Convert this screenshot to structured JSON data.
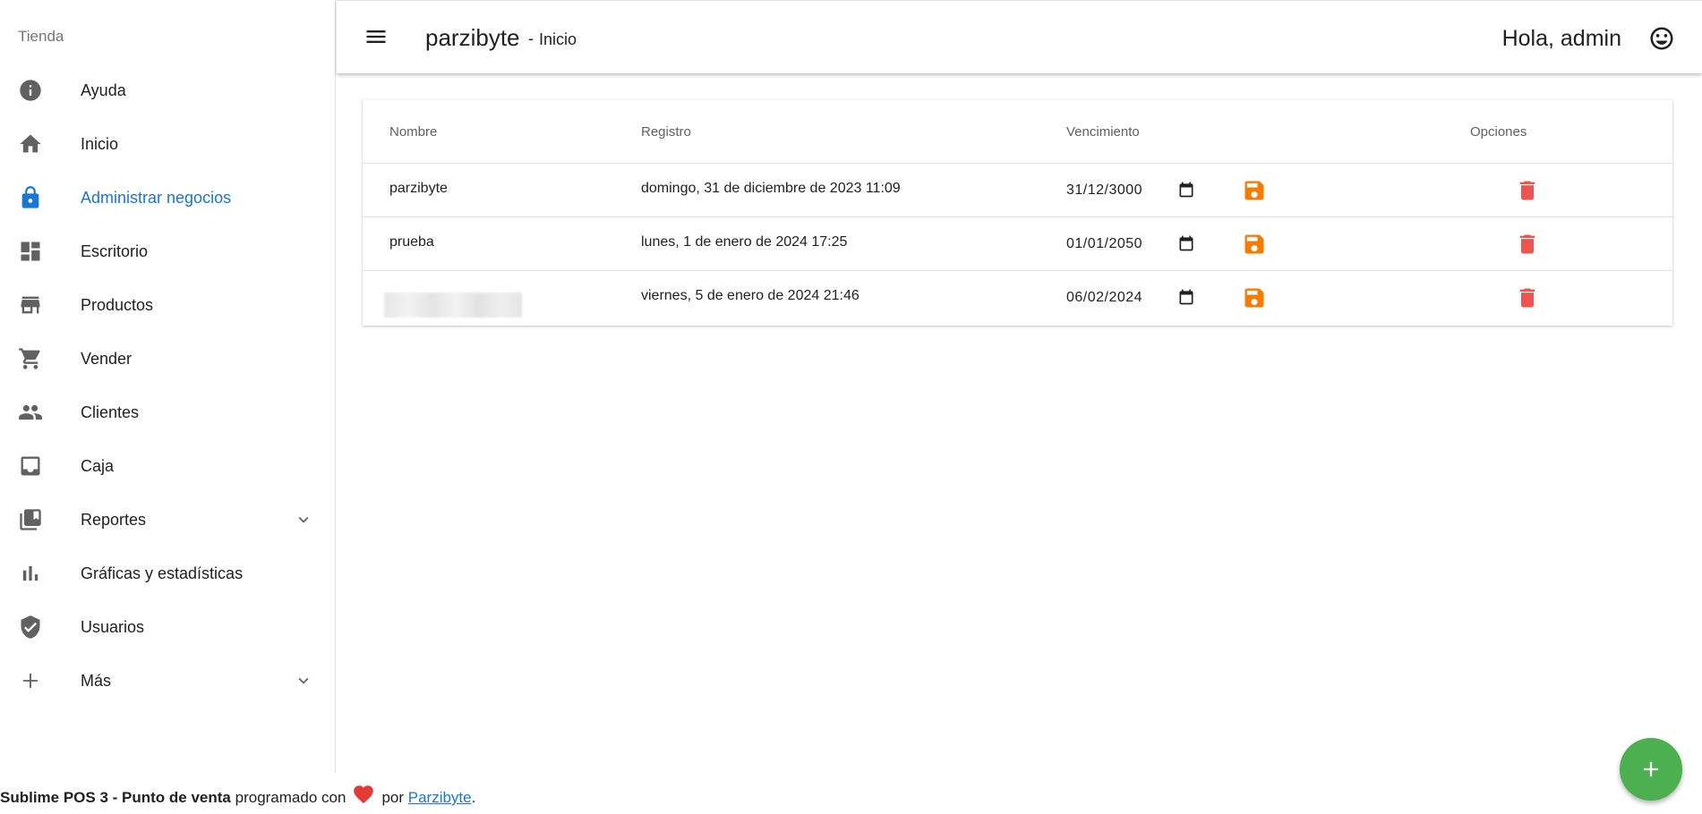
{
  "sidebar": {
    "heading": "Tienda",
    "items": [
      {
        "label": "Ayuda",
        "icon": "info-icon"
      },
      {
        "label": "Inicio",
        "icon": "home-icon"
      },
      {
        "label": "Administrar negocios",
        "icon": "lock-icon",
        "active": true
      },
      {
        "label": "Escritorio",
        "icon": "dashboard-icon"
      },
      {
        "label": "Productos",
        "icon": "store-icon"
      },
      {
        "label": "Vender",
        "icon": "cart-icon"
      },
      {
        "label": "Clientes",
        "icon": "people-icon"
      },
      {
        "label": "Caja",
        "icon": "inbox-icon"
      },
      {
        "label": "Reportes",
        "icon": "library-icon",
        "expandable": true
      },
      {
        "label": "Gráficas y estadísticas",
        "icon": "bar-chart-icon"
      },
      {
        "label": "Usuarios",
        "icon": "verified-user-icon"
      },
      {
        "label": "Más",
        "icon": "plus-icon",
        "expandable": true
      }
    ]
  },
  "header": {
    "brand": "parzibyte",
    "separator": "-",
    "page": "Inicio",
    "greeting": "Hola, admin"
  },
  "table": {
    "columns": {
      "name": "Nombre",
      "registered": "Registro",
      "expires": "Vencimiento",
      "options": "Opciones"
    },
    "rows": [
      {
        "name": "parzibyte",
        "registered": "domingo, 31 de diciembre de 2023 11:09",
        "expires": "31/12/3000",
        "redacted": false
      },
      {
        "name": "prueba",
        "registered": "lunes, 1 de enero de 2024 17:25",
        "expires": "01/01/2050",
        "redacted": false
      },
      {
        "name": "",
        "registered": "viernes, 5 de enero de 2024 21:46",
        "expires": "06/02/2024",
        "redacted": true
      }
    ]
  },
  "footer": {
    "product": "Sublime POS 3 - Punto de venta",
    "made_with": "programado con",
    "by": "por",
    "author_link": "Parzibyte",
    "end": "."
  },
  "colors": {
    "accent": "#1976d2",
    "save": "#f57c00",
    "delete": "#ef5350",
    "fab": "#4caf50",
    "heart": "#e53935"
  }
}
